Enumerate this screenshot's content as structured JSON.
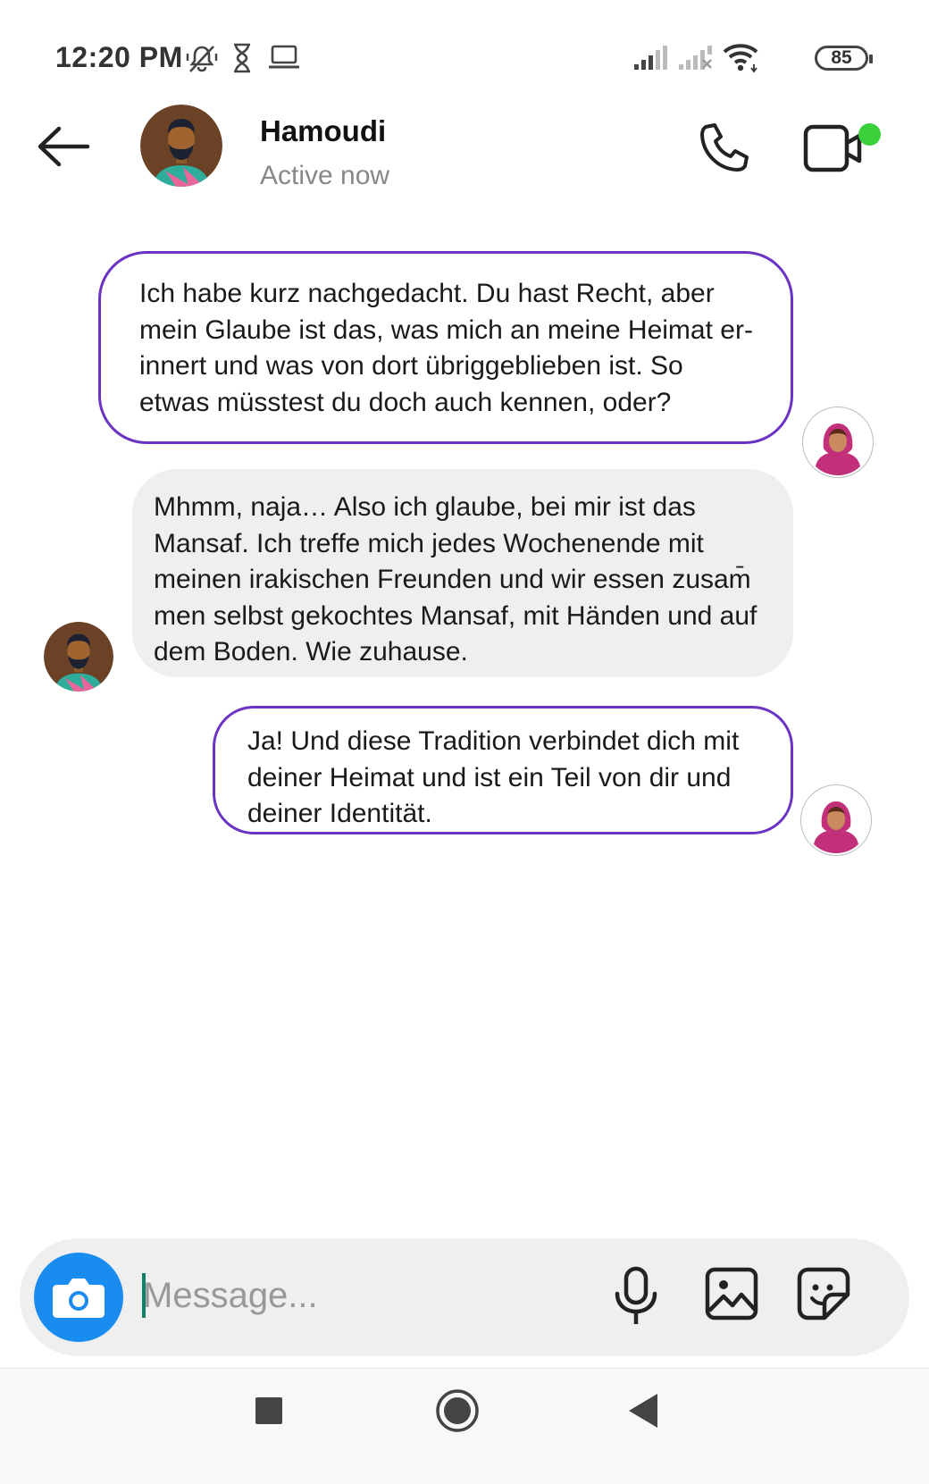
{
  "status_bar": {
    "time": "12:20 PM",
    "battery": "85",
    "icons": [
      "vibrate-off-icon",
      "hourglass-icon",
      "laptop-icon",
      "signal-icon",
      "signal-no-service-icon",
      "wifi-icon",
      "battery-icon"
    ]
  },
  "header": {
    "contact_name": "Hamoudi",
    "status": "Active now",
    "icons": [
      "back-arrow-icon",
      "phone-icon",
      "video-call-icon"
    ],
    "online_color": "#3ad03a"
  },
  "messages": [
    {
      "direction": "outgoing",
      "lines": [
        " Ich habe kurz nachgedacht. Du hast Recht, aber",
        "mein Glaube ist das, was mich an meine Heimat er-",
        "innert und was von dort übriggeblieben ist. So",
        "etwas müsstest du doch auch kennen, oder?"
      ]
    },
    {
      "direction": "incoming",
      "lines": [
        "Mhmm, naja… Also ich glaube, bei mir ist das",
        "Mansaf. Ich treffe mich jedes Wochenende mit",
        "meinen irakischen Freunden und wir essen zusam̄",
        "men selbst gekochtes Mansaf, mit Händen und auf",
        "dem Boden. Wie zuhause."
      ]
    },
    {
      "direction": "outgoing",
      "lines": [
        "Ja! Und diese Tradition verbindet dich mit",
        "deiner Heimat und ist ein Teil von dir und",
        "deiner Identität."
      ]
    }
  ],
  "composer": {
    "placeholder": "Message...",
    "icons": [
      "camera-icon",
      "microphone-icon",
      "image-icon",
      "sticker-icon"
    ]
  },
  "nav_bar": {
    "icons": [
      "recents-square-icon",
      "home-circle-icon",
      "back-triangle-icon"
    ]
  },
  "colors": {
    "accent_purple": "#6b33c4",
    "camera_blue": "#1a8cf0",
    "incoming_bubble": "#efefef"
  }
}
